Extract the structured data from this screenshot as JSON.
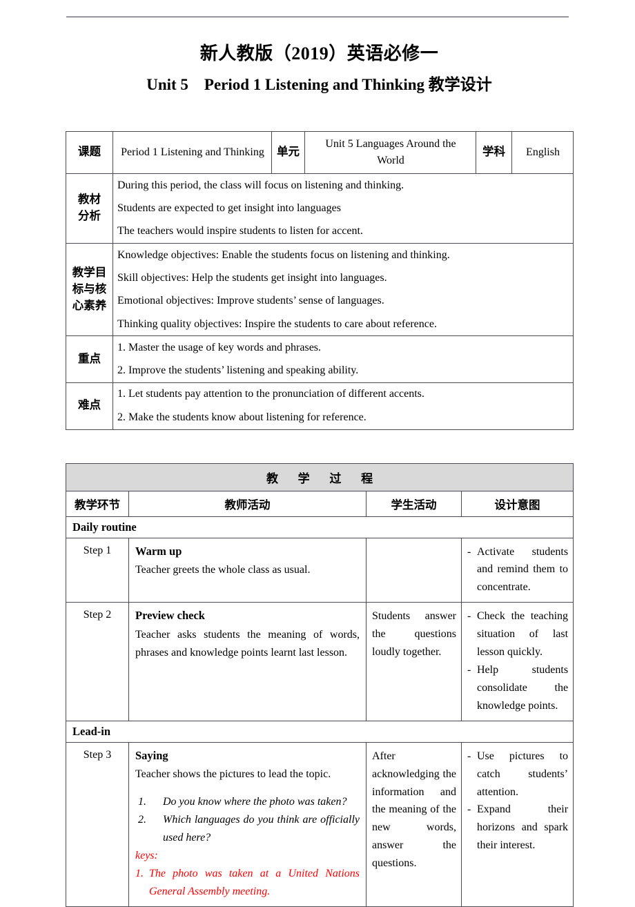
{
  "title_line_1": "新人教版（2019）英语必修一",
  "title_line_2": "Unit 5    Period 1 Listening and Thinking 教学设计",
  "info_table": {
    "labels": {
      "topic": "课题",
      "unit": "单元",
      "subject": "学科",
      "material_analysis": "教材\n分析",
      "objectives": "教学目\n标与核\n心素养",
      "key_points": "重点",
      "difficult_points": "难点"
    },
    "topic_value": "Period 1 Listening and Thinking",
    "unit_value": "Unit 5 Languages Around the World",
    "subject_value": "English",
    "material_analysis_lines": [
      "During this period, the class will focus on listening and thinking.",
      "Students are expected to get insight into languages",
      "The teachers would inspire students to listen for accent."
    ],
    "objectives_lines": [
      "Knowledge objectives: Enable the students focus on listening and thinking.",
      "Skill objectives: Help the students get insight into languages.",
      "Emotional objectives: Improve students’ sense of languages.",
      "Thinking quality objectives: Inspire the students to care about reference."
    ],
    "key_points_lines": [
      "1. Master the usage of key words and phrases.",
      "2. Improve the students’ listening and speaking ability."
    ],
    "difficult_points_lines": [
      "1. Let students pay attention to the pronunciation of different accents.",
      "2. Make the students know about listening for reference."
    ]
  },
  "process_table": {
    "banner": "教 学 过 程",
    "headers": {
      "stage": "教学环节",
      "teacher_activity": "教师活动",
      "student_activity": "学生活动",
      "design_intent": "设计意图"
    },
    "sections": [
      {
        "label": "Daily routine"
      },
      {
        "label": "Lead-in"
      }
    ],
    "rows": [
      {
        "step": "Step 1",
        "teacher_heading": "Warm up",
        "teacher_text": "Teacher greets the whole class as usual.",
        "student_text": "",
        "design_items": [
          "Activate students and remind them to concentrate."
        ]
      },
      {
        "step": "Step 2",
        "teacher_heading": "Preview check",
        "teacher_text": "Teacher asks students the meaning of words, phrases and knowledge points learnt last lesson.",
        "student_text": "Students answer the questions loudly together.",
        "design_items": [
          "Check the teaching situation of last lesson quickly.",
          "Help students consolidate the knowledge points."
        ]
      },
      {
        "step": "Step 3",
        "teacher_heading": "Saying",
        "teacher_text": "Teacher shows the pictures to lead the topic.",
        "questions": [
          {
            "num": "1.",
            "text": "Do you know where the photo was taken?"
          },
          {
            "num": "2.",
            "text": "Which languages do you think are officially used here?"
          }
        ],
        "keys_label": "keys:",
        "keys_items": [
          {
            "num": "1.",
            "text": "The photo was taken at a United Nations General Assembly meeting."
          }
        ],
        "student_text": "After acknowledging the information and the meaning of the new words, answer the questions.",
        "design_items": [
          "Use pictures to catch students’ attention.",
          "Expand their horizons and spark their interest."
        ]
      }
    ]
  },
  "colors": {
    "keys_red": "#ff0000",
    "banner_gray": "#d9d9d9",
    "border": "#4a4a52"
  }
}
